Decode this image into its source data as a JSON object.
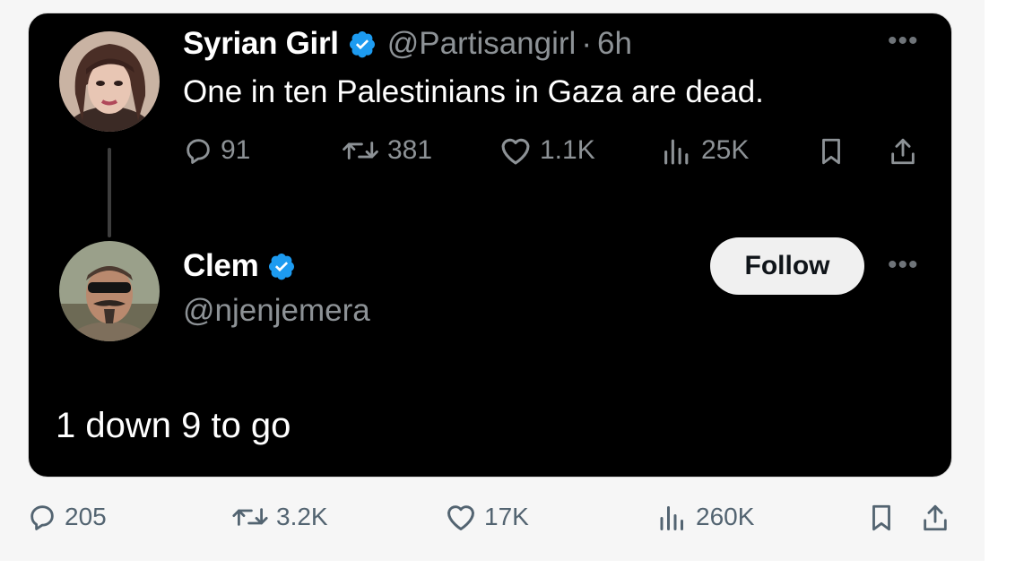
{
  "quoted_tweet": {
    "author_name": "Syrian Girl",
    "handle": "@Partisangirl",
    "separator": "·",
    "time": "6h",
    "text": "One in ten Palestinians in Gaza are dead.",
    "more_icon": "more-horizontal-icon",
    "stats": {
      "replies": "91",
      "retweets": "381",
      "likes": "1.1K",
      "views": "25K"
    }
  },
  "reply": {
    "author_name": "Clem",
    "handle": "@njenjemera",
    "follow_label": "Follow",
    "text": "1 down 9 to go",
    "more_icon": "more-horizontal-icon"
  },
  "post_stats": {
    "replies": "205",
    "retweets": "3.2K",
    "likes": "17K",
    "views": "260K"
  },
  "colors": {
    "verified": "#1d9bf0",
    "card_background": "#000000",
    "page_background": "#f6f6f6",
    "muted_text": "#8d9296"
  }
}
